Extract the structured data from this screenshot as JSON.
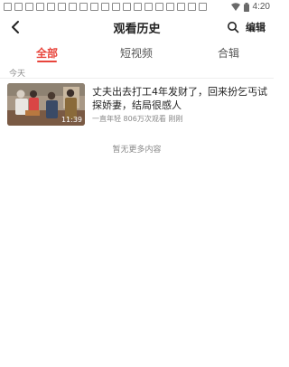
{
  "status_bar": {
    "time": "4:20"
  },
  "header": {
    "title": "观看历史",
    "edit_label": "编辑"
  },
  "tabs": [
    {
      "label": "全部",
      "active": true
    },
    {
      "label": "短视频",
      "active": false
    },
    {
      "label": "合辑",
      "active": false
    }
  ],
  "history": {
    "section_label": "今天",
    "items": [
      {
        "title": "丈夫出去打工4年发财了，回来扮乞丐试探娇妻，结局很感人",
        "duration": "11:39",
        "author": "一直年轻",
        "views": "806万次观看",
        "watched": "刚刚"
      }
    ],
    "end_text": "暂无更多内容"
  },
  "colors": {
    "accent": "#e8453c",
    "text": "#222222",
    "muted": "#8a8a8a"
  },
  "icons": {
    "back": "back-arrow-icon",
    "search": "search-icon",
    "wifi": "wifi-icon",
    "battery": "battery-icon"
  }
}
